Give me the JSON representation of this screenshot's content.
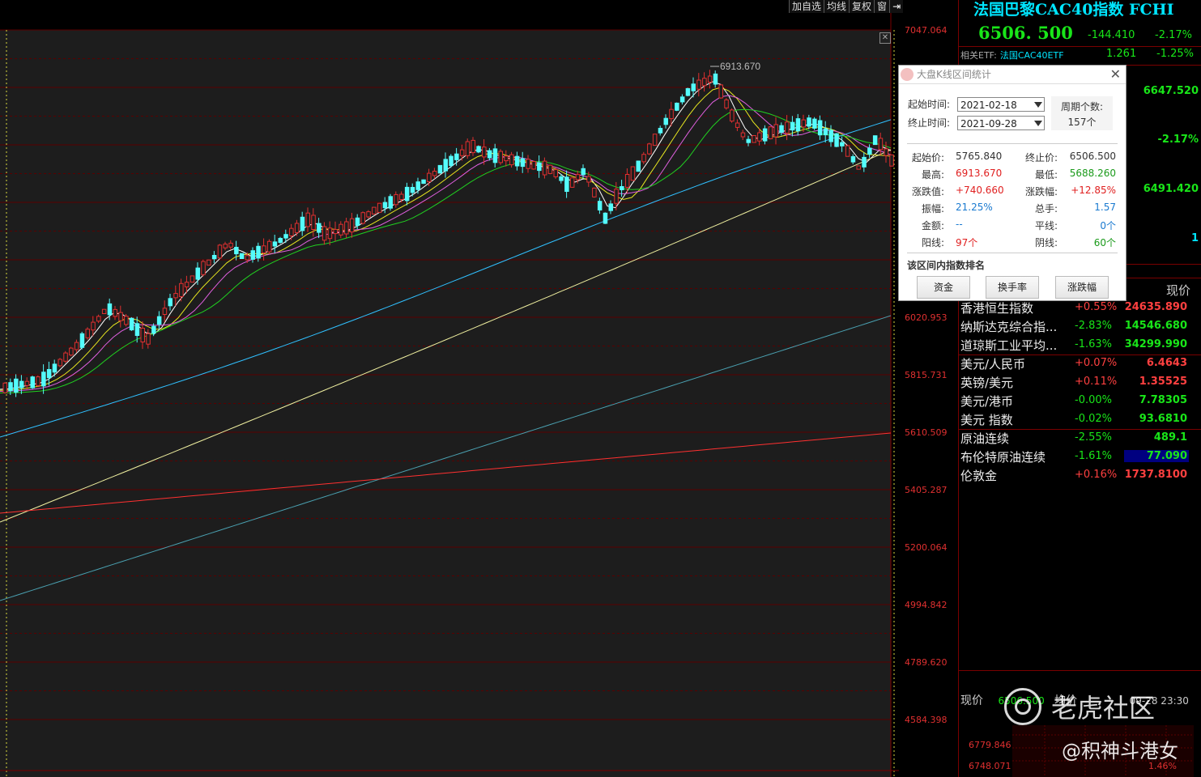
{
  "toolbar": {
    "items": [
      "加自选",
      "均线",
      "复权",
      "窗"
    ]
  },
  "chart": {
    "peak_label": "6913.670",
    "y_axis": [
      "7047.064",
      "6020.953",
      "5815.731",
      "5610.509",
      "5405.287",
      "5200.064",
      "4994.842",
      "4789.620",
      "4584.398"
    ],
    "colors": {
      "up": "#e03030",
      "down": "#54fcfc",
      "bg": "#1d1d1d"
    }
  },
  "quote": {
    "title": "法国巴黎CAC40指数 FCHI",
    "price": "6506. 500",
    "change": "-144.410",
    "pct": "-2.17%",
    "etf_label": "相关ETF:",
    "etf_name": "法国CAC40ETF",
    "etf_price": "1.261",
    "etf_pct": "-1.25%",
    "side_values": [
      "6647.520",
      "-2.17%",
      "6491.420",
      "1"
    ]
  },
  "dialog": {
    "title": "大盘K线区间统计",
    "start_label": "起始时间:",
    "end_label": "终止时间:",
    "start_date": "2021-02-18",
    "end_date": "2021-09-28",
    "period_label": "周期个数:",
    "period_value": "157个",
    "stats": [
      {
        "l": "起始价:",
        "v": "5765.840",
        "l2": "终止价:",
        "v2": "6506.500",
        "c": "#333",
        "c2": "#333"
      },
      {
        "l": "最高:",
        "v": "6913.670",
        "l2": "最低:",
        "v2": "5688.260",
        "c": "#e02020",
        "c2": "#1a9a1a"
      },
      {
        "l": "涨跌值:",
        "v": "+740.660",
        "l2": "涨跌幅:",
        "v2": "+12.85%",
        "c": "#e02020",
        "c2": "#e02020"
      },
      {
        "l": "振幅:",
        "v": "21.25%",
        "l2": "总手:",
        "v2": "1.57",
        "c": "#1a7ad0",
        "c2": "#1a7ad0"
      },
      {
        "l": "金额:",
        "v": "--",
        "l2": "平线:",
        "v2": "0个",
        "c": "#1a7ad0",
        "c2": "#1a7ad0"
      },
      {
        "l": "阳线:",
        "v": "97个",
        "l2": "阴线:",
        "v2": "60个",
        "c": "#e02020",
        "c2": "#1a9a1a"
      }
    ],
    "rank_title": "该区间内指数排名",
    "buttons": [
      "资金",
      "换手率",
      "涨跌幅"
    ]
  },
  "market": {
    "header": "现价",
    "rows": [
      {
        "name": "香港恒生指数",
        "pct": "+0.55%",
        "price": "24635.890",
        "up": true
      },
      {
        "name": "纳斯达克综合指...",
        "pct": "-2.83%",
        "price": "14546.680",
        "up": false
      },
      {
        "name": "道琼斯工业平均...",
        "pct": "-1.63%",
        "price": "34299.990",
        "up": false
      },
      {
        "name": "美元/人民币",
        "pct": "+0.07%",
        "price": "6.4643",
        "up": true
      },
      {
        "name": "英镑/美元",
        "pct": "+0.11%",
        "price": "1.35525",
        "up": true
      },
      {
        "name": "美元/港币",
        "pct": "-0.00%",
        "price": "7.78305",
        "up": false
      },
      {
        "name": "美元 指数",
        "pct": "-0.02%",
        "price": "93.6810",
        "up": false
      },
      {
        "name": "原油连续",
        "pct": "-2.55%",
        "price": "489.1",
        "up": false
      },
      {
        "name": "布伦特原油连续",
        "pct": "-1.61%",
        "price": "77.090",
        "up": false,
        "hl": true
      },
      {
        "name": "伦敦金",
        "pct": "+0.16%",
        "price": "1737.8100",
        "up": true
      }
    ]
  },
  "bottom": {
    "label": "现价",
    "price": "6506.500",
    "avg_label": "均价",
    "time": "09-28 23:30",
    "mini_top": "6779.846",
    "mini_bottom": "6748.071",
    "mini_pct": "1.46%"
  },
  "watermark": {
    "brand": "老虎社区",
    "handle": "@积神斗港女"
  }
}
